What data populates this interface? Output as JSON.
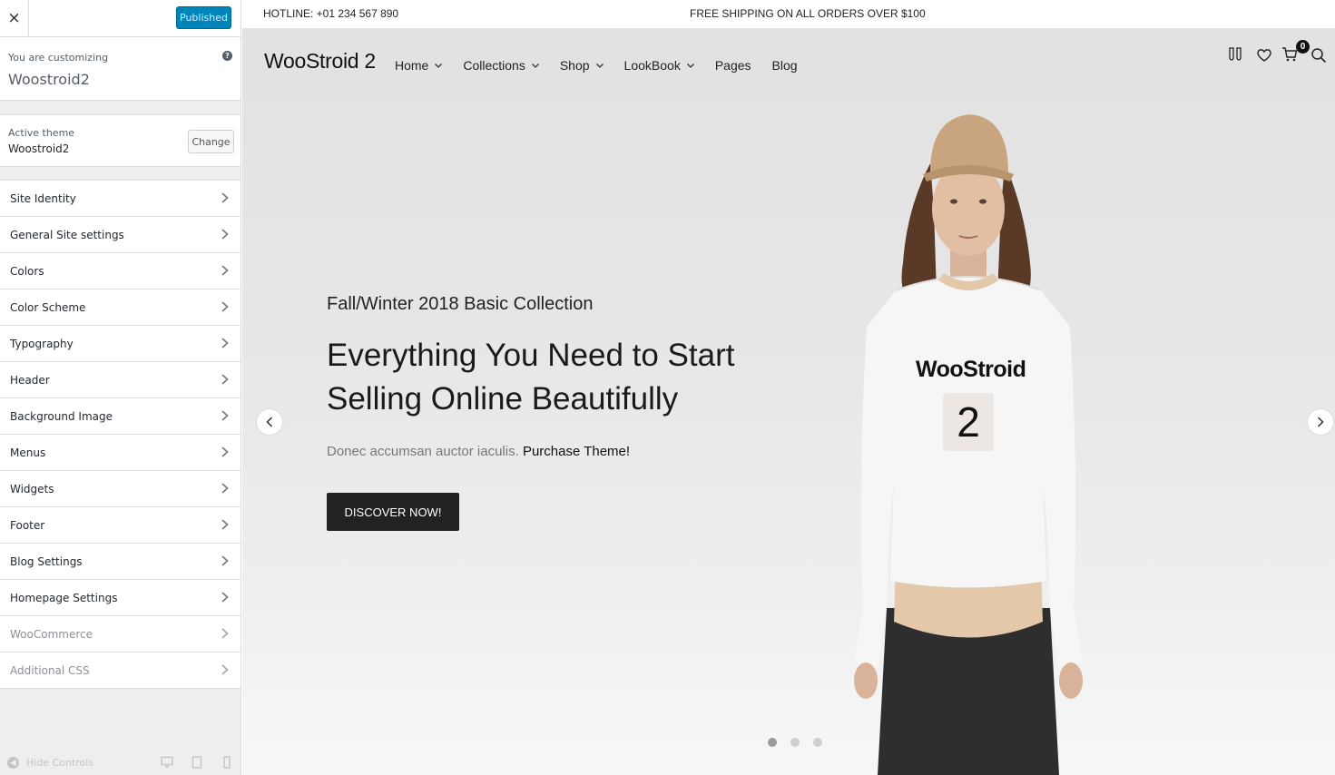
{
  "customizer": {
    "close_label": "×",
    "published_label": "Published",
    "customizing_label": "You are customizing",
    "site_name": "Woostroid2",
    "help_label": "?",
    "active_theme_label": "Active theme",
    "active_theme_name": "Woostroid2",
    "change_label": "Change",
    "sections": [
      "Site Identity",
      "General Site settings",
      "Colors",
      "Color Scheme",
      "Typography",
      "Header",
      "Background Image",
      "Menus",
      "Widgets",
      "Footer",
      "Blog Settings",
      "Homepage Settings",
      "WooCommerce",
      "Additional CSS"
    ],
    "hide_controls_label": "Hide Controls",
    "devices": [
      "desktop-icon",
      "tablet-icon",
      "mobile-icon"
    ]
  },
  "store": {
    "hotline": "HOTLINE: +01 234 567 890",
    "shipping": "FREE SHIPPING ON ALL ORDERS OVER $100",
    "logo": "WooStroid 2",
    "nav": [
      {
        "label": "Home",
        "dropdown": true
      },
      {
        "label": "Collections",
        "dropdown": true
      },
      {
        "label": "Shop",
        "dropdown": true
      },
      {
        "label": "LookBook",
        "dropdown": true
      },
      {
        "label": "Pages",
        "dropdown": false
      },
      {
        "label": "Blog",
        "dropdown": false
      }
    ],
    "header_icons": [
      "compare-icon",
      "heart-icon",
      "cart-icon",
      "search-icon"
    ],
    "cart_count": "0",
    "hero": {
      "subtitle": "Fall/Winter 2018 Basic Collection",
      "title": "Everything You Need to Start Selling Online Beautifully",
      "description": "Donec accumsan auctor iaculis.",
      "description_link": "Purchase Theme!",
      "button": "DISCOVER NOW!",
      "shirt_text": "WooStroid",
      "shirt_number": "2"
    },
    "slider": {
      "total": 3,
      "active": 1
    },
    "colors": {
      "accent": "#0085ba",
      "button_bg": "#222222",
      "hat": "#c8a57e",
      "sweater": "#f6f6f6",
      "undershirt": "#e3c9aa",
      "skirt": "#2e2e2e"
    }
  }
}
